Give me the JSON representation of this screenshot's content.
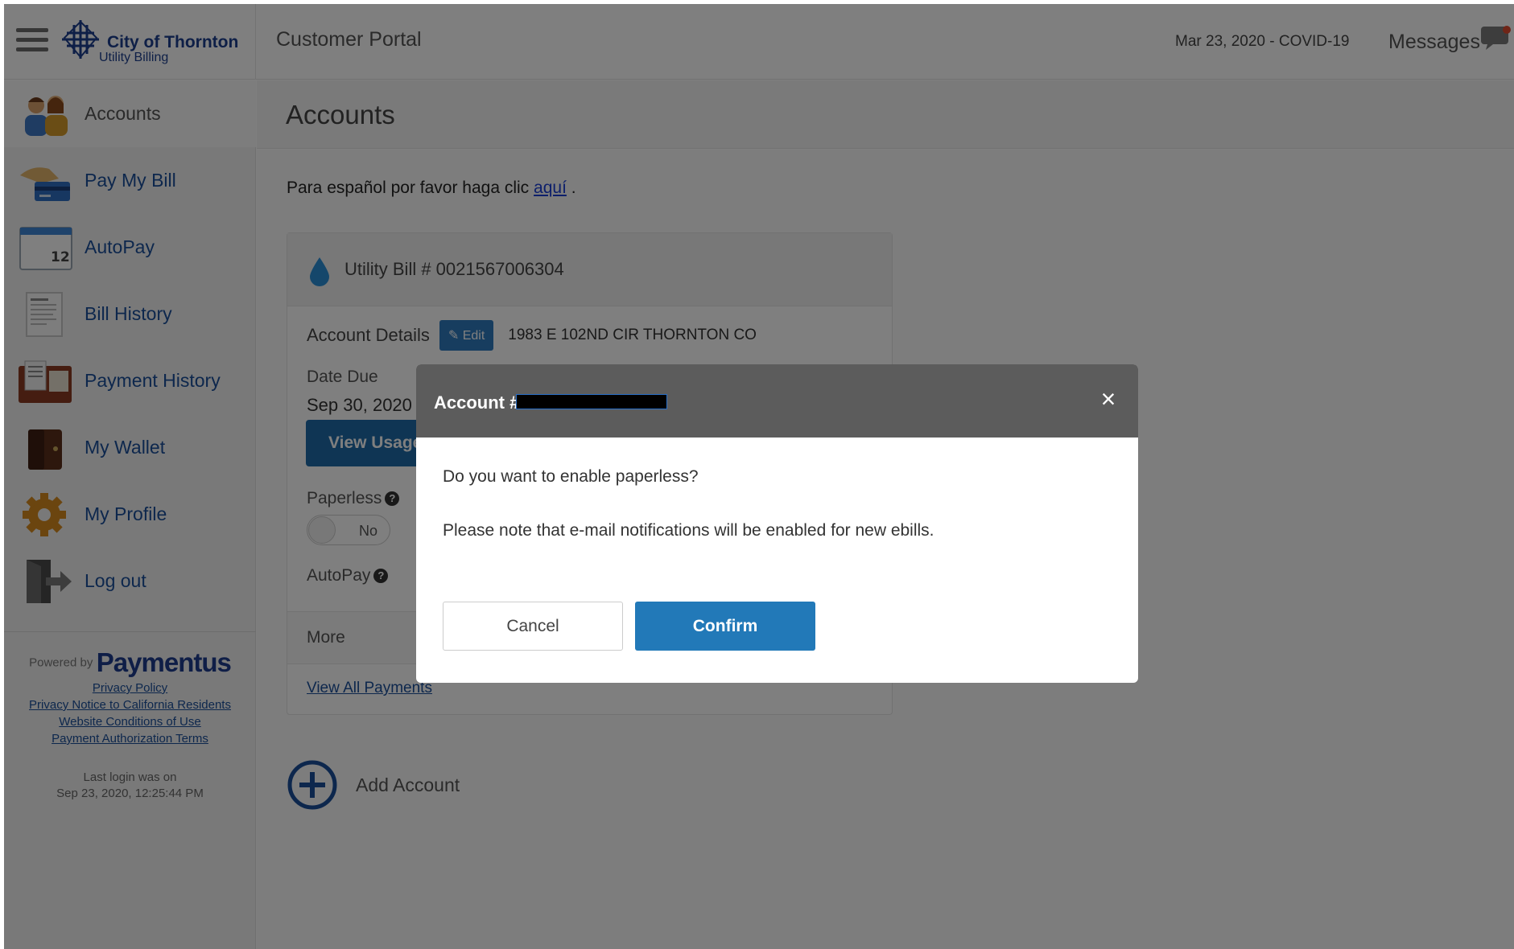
{
  "header": {
    "brand_title": "City of Thornton",
    "brand_subtitle": "Utility Billing",
    "portal_title": "Customer Portal",
    "covid_link": "Mar 23, 2020 - COVID-19",
    "messages_label": "Messages"
  },
  "sidebar": {
    "items": [
      {
        "label": "Accounts",
        "icon": "accounts-icon"
      },
      {
        "label": "Pay My Bill",
        "icon": "pay-bill-icon"
      },
      {
        "label": "AutoPay",
        "icon": "calendar-icon"
      },
      {
        "label": "Bill History",
        "icon": "invoice-icon"
      },
      {
        "label": "Payment History",
        "icon": "payment-history-icon"
      },
      {
        "label": "My Wallet",
        "icon": "wallet-icon"
      },
      {
        "label": "My Profile",
        "icon": "gear-icon"
      },
      {
        "label": "Log out",
        "icon": "logout-icon"
      }
    ],
    "calendar_day": "12",
    "powered_by": "Powered by",
    "powered_brand": "Paymentus",
    "links": [
      "Privacy Policy",
      "Privacy Notice to California Residents",
      "Website Conditions of Use",
      "Payment Authorization Terms"
    ],
    "last_login_label": "Last login was on",
    "last_login_value": "Sep 23, 2020, 12:25:44 PM"
  },
  "page": {
    "title": "Accounts",
    "spanish_text": "Para español por favor haga clic",
    "spanish_link": "aquí",
    "spanish_suffix": "."
  },
  "card": {
    "title": "Utility Bill # 0021567006304",
    "account_details_label": "Account Details",
    "edit_label": "Edit",
    "address": "1983 E 102ND CIR THORNTON CO",
    "date_due_label": "Date Due",
    "date_due_value": "Sep 30, 2020",
    "view_usage_label": "View Usage",
    "paperless_label": "Paperless",
    "paperless_toggle": "No",
    "autopay_label": "AutoPay",
    "more_label": "More",
    "view_payments_link": "View All Payments"
  },
  "add_account_label": "Add Account",
  "modal": {
    "title": "Account #",
    "question": "Do you want to enable paperless?",
    "note": "Please note that e-mail notifications will be enabled for new ebills.",
    "cancel_label": "Cancel",
    "confirm_label": "Confirm",
    "close_glyph": "×"
  },
  "colors": {
    "brand_blue": "#1c3f8f",
    "link_blue": "#1b4f9a",
    "confirm_blue": "#2279b8",
    "modal_header": "#5c5c5c"
  }
}
